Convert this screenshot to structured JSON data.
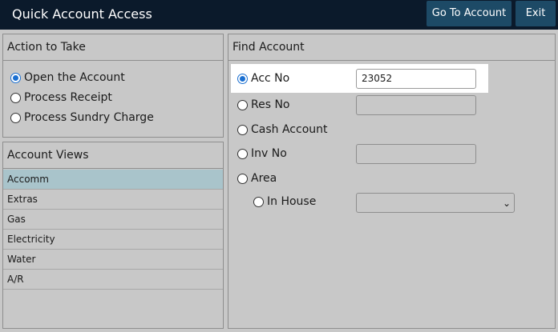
{
  "window": {
    "title": "Quick Account Access",
    "go_to_account_label": "Go To Account",
    "exit_label": "Exit"
  },
  "action_panel": {
    "title": "Action to Take",
    "options": [
      {
        "label": "Open the Account",
        "checked": true
      },
      {
        "label": "Process Receipt",
        "checked": false
      },
      {
        "label": "Process Sundry Charge",
        "checked": false
      }
    ]
  },
  "views_panel": {
    "title": "Account Views",
    "items": [
      "Accomm",
      "Extras",
      "Gas",
      "Electricity",
      "Water",
      "A/R"
    ],
    "selected": "Accomm"
  },
  "find_panel": {
    "title": "Find Account",
    "options": {
      "acc_no": {
        "label": "Acc No",
        "checked": true,
        "value": "23052"
      },
      "res_no": {
        "label": "Res No",
        "checked": false,
        "value": ""
      },
      "cash_account": {
        "label": "Cash Account",
        "checked": false
      },
      "inv_no": {
        "label": "Inv No",
        "checked": false,
        "value": ""
      },
      "area": {
        "label": "Area",
        "checked": false
      },
      "in_house": {
        "label": "In House",
        "checked": false,
        "value": ""
      }
    }
  },
  "colors": {
    "titlebar": "#0b1a2b",
    "button": "#1d4a66",
    "background": "#c8c8c8",
    "selected_row": "#a9c4cb",
    "radio_accent": "#1a6fd1"
  }
}
